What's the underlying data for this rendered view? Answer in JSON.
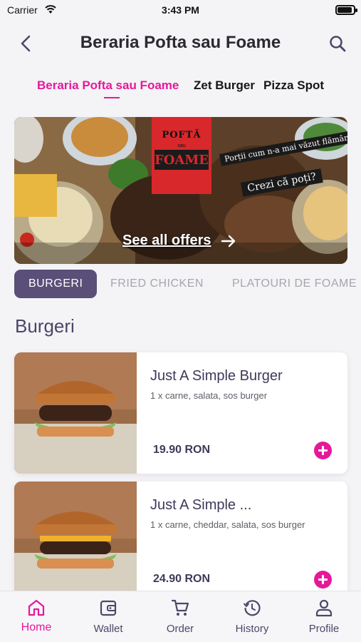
{
  "status_bar": {
    "carrier": "Carrier",
    "time": "3:43 PM"
  },
  "header": {
    "title": "Beraria Pofta sau Foame",
    "back_icon": "chevron-left-icon",
    "search_icon": "search-icon"
  },
  "venue_tabs": [
    {
      "label": "Beraria Pofta sau Foame",
      "active": true
    },
    {
      "label": "Zet Burger",
      "active": false
    },
    {
      "label": "Pizza Spot",
      "active": false
    }
  ],
  "banner": {
    "logo_line1": "POFTĂ",
    "logo_sep": "sau",
    "logo_line2": "FOAME",
    "tagline1": "Porții cum n-a mai văzut flămândul!",
    "tagline2": "Crezi că poți?",
    "cta": "See all offers",
    "cta_icon": "arrow-right-icon"
  },
  "categories": [
    {
      "label": "BURGERI",
      "active": true
    },
    {
      "label": "FRIED CHICKEN",
      "active": false
    },
    {
      "label": "PLATOURI DE FOAME",
      "active": false
    }
  ],
  "section_title": "Burgeri",
  "products": [
    {
      "name": "Just A Simple Burger",
      "description": "1 x carne, salata, sos burger",
      "price": "19.90 RON"
    },
    {
      "name": "Just A Simple ...",
      "description": "1 x carne, cheddar, salata, sos burger",
      "price": "24.90 RON"
    }
  ],
  "tab_bar": [
    {
      "label": "Home",
      "icon": "home-icon",
      "active": true
    },
    {
      "label": "Wallet",
      "icon": "wallet-icon",
      "active": false
    },
    {
      "label": "Order",
      "icon": "cart-icon",
      "active": false
    },
    {
      "label": "History",
      "icon": "history-icon",
      "active": false
    },
    {
      "label": "Profile",
      "icon": "profile-icon",
      "active": false
    }
  ],
  "colors": {
    "accent": "#e6189a",
    "primary": "#5a4f78",
    "text_dark": "#3e3a5a",
    "inactive": "#a8a6ad",
    "background": "#f4f3f6"
  }
}
